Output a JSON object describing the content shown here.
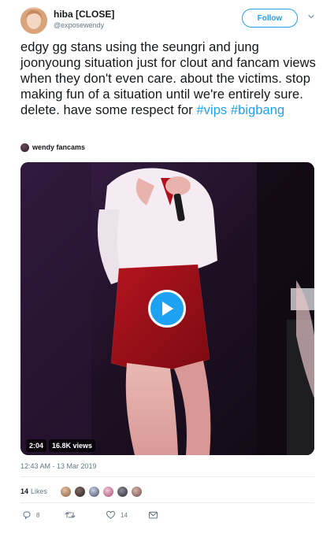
{
  "tweet": {
    "author_name": "hiba [CLOSE]",
    "author_handle": "@exposewendy",
    "follow_label": "Follow",
    "text_segments": [
      "edgy gg stans using the seungri and jung joonyoung situation just for clout and fancam views when they don't even care. about the victims. stop making fun of a situation until we're entirely sure. delete. have some respect for "
    ],
    "hashtags": [
      "#vips",
      "#bigbang"
    ],
    "via_name": "wendy fancams",
    "timestamp": "12:43 AM - 13 Mar 2019",
    "likes_count": "14",
    "likes_label": "Likes"
  },
  "media": {
    "duration": "2:04",
    "views": "16.8K views"
  },
  "actions": {
    "reply_count": "8",
    "retweet_count": "",
    "like_count": "14"
  },
  "colors": {
    "accent": "#1da1f2",
    "secondary_text": "#657786",
    "primary_text": "#14171a",
    "divider": "#e6ecf0"
  },
  "icons": [
    "chevron-down-icon",
    "play-icon",
    "reply-icon",
    "retweet-icon",
    "heart-icon",
    "message-icon"
  ]
}
